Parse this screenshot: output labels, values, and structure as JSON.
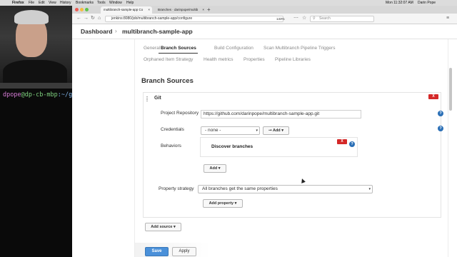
{
  "menubar": {
    "app": "Firefox",
    "items": [
      "File",
      "Edit",
      "View",
      "History",
      "Bookmarks",
      "Tools",
      "Window",
      "Help"
    ],
    "clock": "Mon 11:32:07 AM",
    "user": "Darin Pope"
  },
  "terminal": {
    "user": "dpope",
    "at": "@",
    "host": "dp-cb-mbp",
    "path": ":~/gi"
  },
  "browser": {
    "tabs": [
      {
        "label": "multibranch-sample-app Co",
        "active": true
      },
      {
        "label": "Branches · darinpope/multib",
        "active": false
      }
    ],
    "newtab_icon": "+",
    "url": "jenkins:8080/job/multibranch-sample-app/configure",
    "zoom": "133%",
    "search_placeholder": "Search"
  },
  "breadcrumb": {
    "dashboard": "Dashboard",
    "separator": "›",
    "project": "multibranch-sample-app"
  },
  "config_tabs": [
    "General",
    "Branch Sources",
    "Build Configuration",
    "Scan Multibranch Pipeline Triggers",
    "Orphaned Item Strategy",
    "Health metrics",
    "Properties",
    "Pipeline Libraries"
  ],
  "section": {
    "title": "Branch Sources"
  },
  "git_source": {
    "title": "Git",
    "delete_label": "X",
    "help_icon_text": "?",
    "project_repository_label": "Project Repository",
    "project_repository_value": "https://github.com/darinpope/multibranch-sample-app.git",
    "credentials_label": "Credentials",
    "credentials_value": "- none -",
    "credentials_add_label": "Add",
    "behaviors_label": "Behaviors",
    "behavior_item": "Discover branches",
    "behavior_delete_label": "X",
    "behaviors_add_label": "Add",
    "property_strategy_label": "Property strategy",
    "property_strategy_value": "All branches get the same properties",
    "add_property_label": "Add property"
  },
  "add_source_label": "Add source",
  "save_label": "Save",
  "apply_label": "Apply",
  "colors": {
    "delete": "#d42828",
    "help": "#2a6fb6",
    "save": "#4a90d9"
  }
}
